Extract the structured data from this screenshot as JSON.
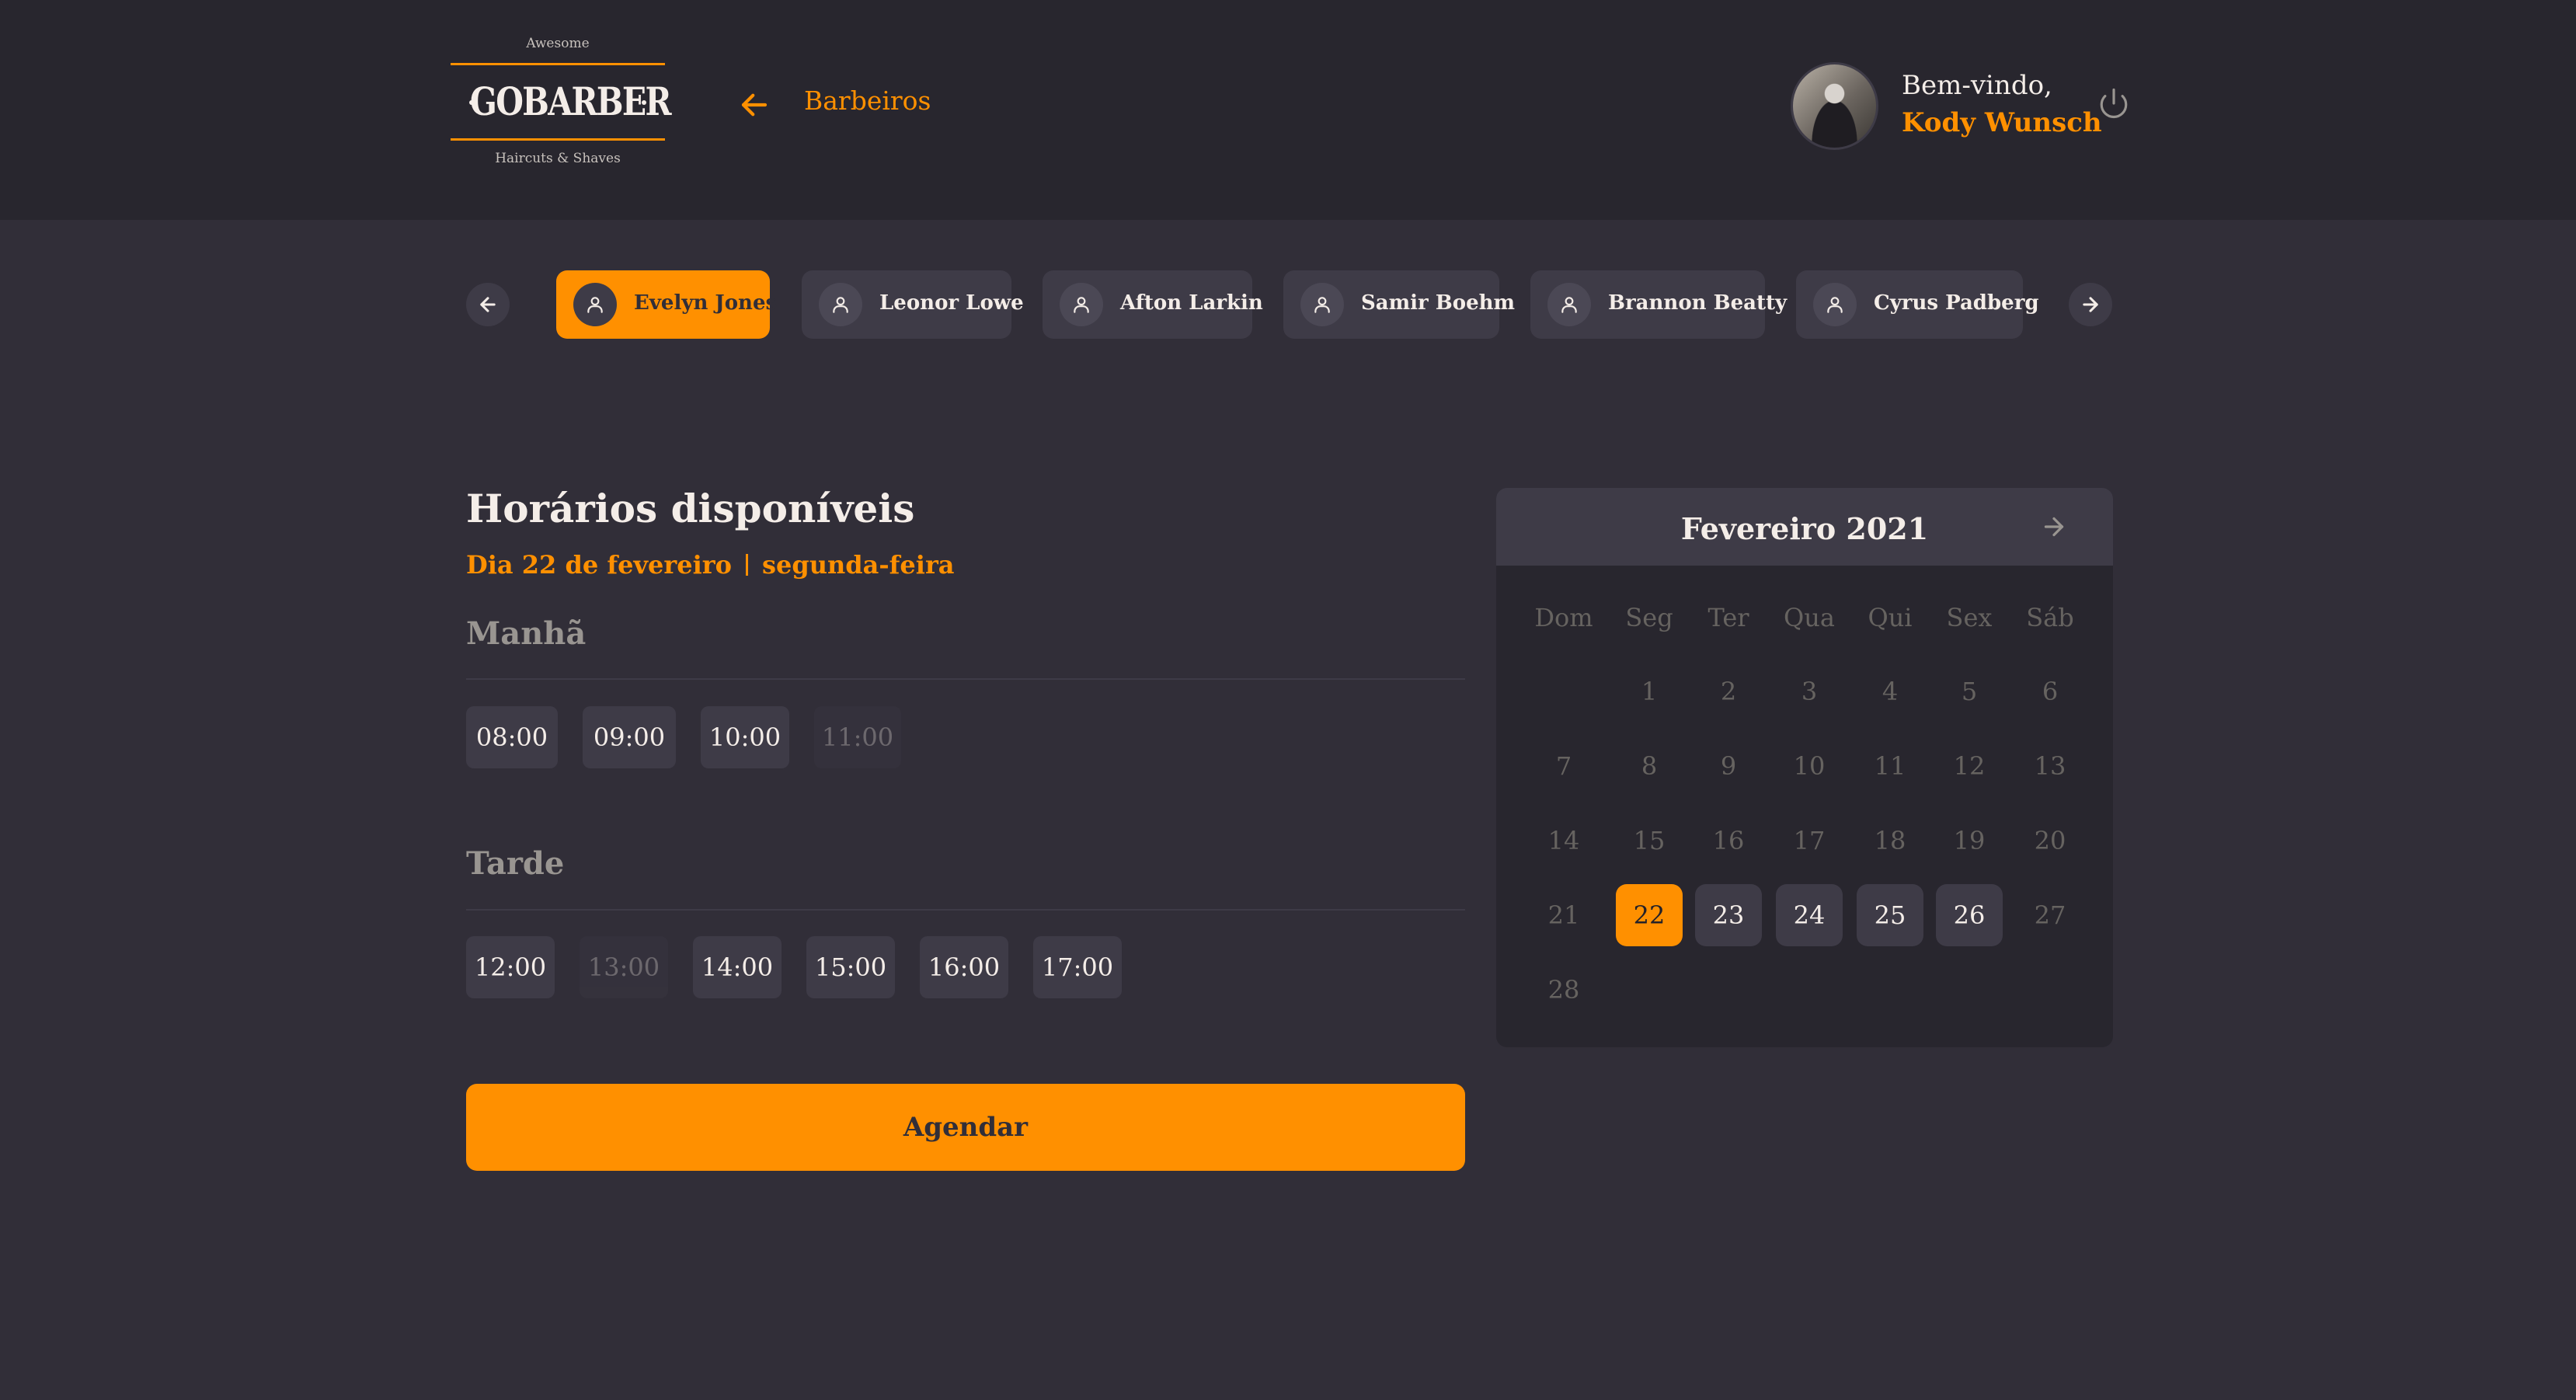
{
  "header": {
    "logo": {
      "top": "Awesome",
      "brand": "GOBARBER",
      "bottom": "Haircuts & Shaves"
    },
    "nav_title": "Barbeiros",
    "welcome": "Bem-vindo,",
    "user_name": "Kody Wunsch"
  },
  "barbers": [
    {
      "name": "Evelyn Jones",
      "selected": true
    },
    {
      "name": "Leonor Lowe",
      "selected": false
    },
    {
      "name": "Afton Larkin",
      "selected": false
    },
    {
      "name": "Samir Boehm",
      "selected": false
    },
    {
      "name": "Brannon Beatty",
      "selected": false
    },
    {
      "name": "Cyrus Padberg",
      "selected": false
    }
  ],
  "schedule": {
    "title": "Horários disponíveis",
    "day": "Dia 22 de fevereiro",
    "weekday": "segunda-feira",
    "morning": {
      "title": "Manhã",
      "slots": [
        {
          "time": "08:00",
          "available": true
        },
        {
          "time": "09:00",
          "available": true
        },
        {
          "time": "10:00",
          "available": true
        },
        {
          "time": "11:00",
          "available": false
        }
      ]
    },
    "afternoon": {
      "title": "Tarde",
      "slots": [
        {
          "time": "12:00",
          "available": true
        },
        {
          "time": "13:00",
          "available": false
        },
        {
          "time": "14:00",
          "available": true
        },
        {
          "time": "15:00",
          "available": true
        },
        {
          "time": "16:00",
          "available": true
        },
        {
          "time": "17:00",
          "available": true
        }
      ]
    },
    "submit_label": "Agendar"
  },
  "calendar": {
    "month": "Fevereiro 2021",
    "weekdays": [
      "Dom",
      "Seg",
      "Ter",
      "Qua",
      "Qui",
      "Sex",
      "Sáb"
    ],
    "first_weekday_index": 1,
    "days_in_month": 28,
    "selected_day": 22,
    "available_days": [
      23,
      24,
      25,
      26
    ]
  },
  "colors": {
    "accent": "#ff9000",
    "background": "#312e38",
    "header": "#28262e",
    "surface": "#3e3b47",
    "muted_text": "#666360"
  }
}
